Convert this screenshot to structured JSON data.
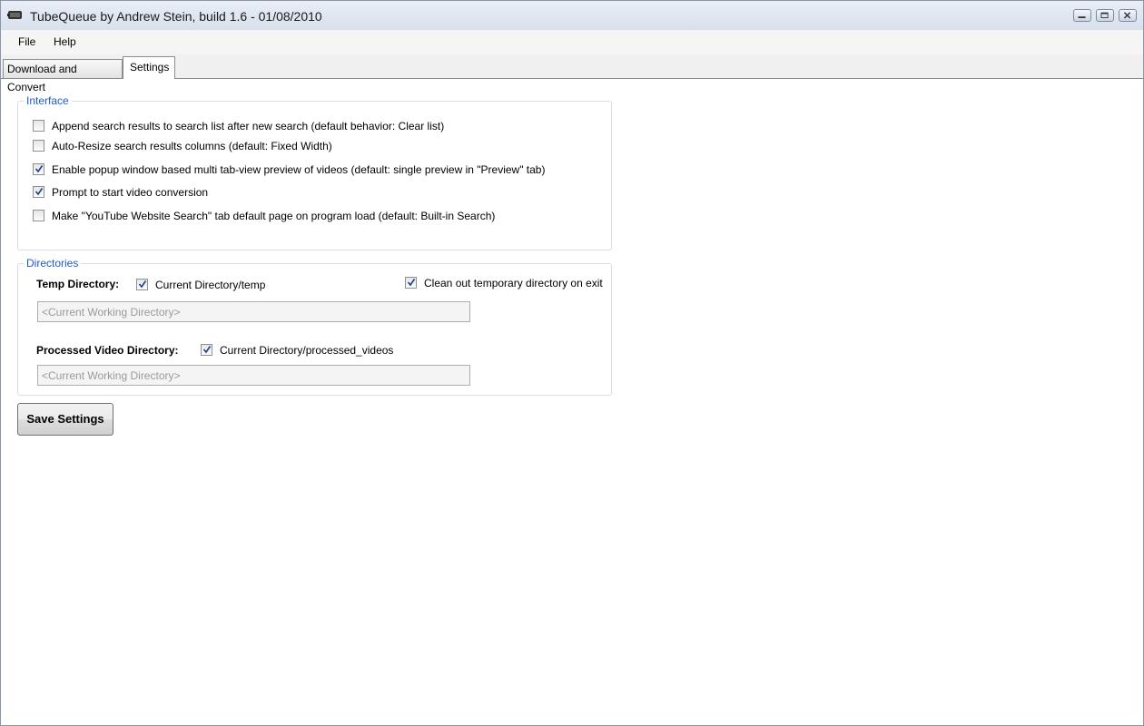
{
  "window": {
    "title": "TubeQueue by Andrew Stein, build 1.6 - 01/08/2010"
  },
  "menu": {
    "file": "File",
    "help": "Help"
  },
  "tabs": {
    "download": "Download and Convert",
    "settings": "Settings"
  },
  "interface_group": {
    "title": "Interface",
    "options": [
      {
        "label": "Append search results to search list after new search (default behavior: Clear list)",
        "checked": false
      },
      {
        "label": "Auto-Resize search results columns (default: Fixed Width)",
        "checked": false
      },
      {
        "label": "Enable popup window based multi tab-view preview of videos (default: single preview in \"Preview\" tab)",
        "checked": true
      },
      {
        "label": "Prompt to start video conversion",
        "checked": true
      },
      {
        "label": "Make \"YouTube Website Search\" tab default page on program load (default: Built-in Search)",
        "checked": false
      }
    ]
  },
  "directories_group": {
    "title": "Directories",
    "temp_label": "Temp Directory:",
    "temp_checkbox": {
      "label": "Current Directory/temp",
      "checked": true
    },
    "clean_checkbox": {
      "label": "Clean out temporary directory on exit",
      "checked": true
    },
    "temp_path": "<Current Working Directory>",
    "processed_label": "Processed Video Directory:",
    "processed_checkbox": {
      "label": "Current Directory/processed_videos",
      "checked": true
    },
    "processed_path": "<Current Working Directory>"
  },
  "save_button": "Save Settings"
}
